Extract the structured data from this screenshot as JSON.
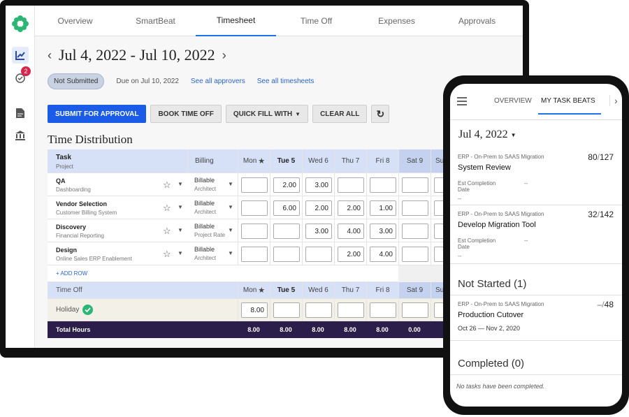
{
  "app": {
    "tabs": [
      "Overview",
      "SmartBeat",
      "Timesheet",
      "Time Off",
      "Expenses",
      "Approvals"
    ],
    "active_tab": "Timesheet",
    "notification_count": "2"
  },
  "timesheet": {
    "date_range": "Jul 4, 2022 - Jul 10, 2022",
    "status": "Not Submitted",
    "due": "Due on Jul 10, 2022",
    "see_approvers": "See all approvers",
    "see_timesheets": "See all timesheets",
    "buttons": {
      "submit": "SUBMIT FOR APPROVAL",
      "book": "BOOK TIME OFF",
      "quick_fill": "QUICK FILL WITH",
      "clear": "CLEAR ALL"
    },
    "section_title": "Time Distribution",
    "header": {
      "task": "Task",
      "project": "Project",
      "billing": "Billing",
      "days": [
        "Mon",
        "Tue 5",
        "Wed 6",
        "Thu 7",
        "Fri 8",
        "Sat 9",
        "Su"
      ]
    },
    "rows": [
      {
        "task": "QA",
        "project": "Dashboarding",
        "billing": "Billable",
        "role": "Architect",
        "hours": [
          "",
          "2.00",
          "3.00",
          "",
          "",
          "",
          ""
        ]
      },
      {
        "task": "Vendor Selection",
        "project": "Customer Billing System",
        "billing": "Billable",
        "role": "Architect",
        "hours": [
          "",
          "6.00",
          "2.00",
          "2.00",
          "1.00",
          "",
          ""
        ]
      },
      {
        "task": "Discovery",
        "project": "Financial Reporting",
        "billing": "Billable",
        "role": "Project Rate",
        "hours": [
          "",
          "",
          "3.00",
          "4.00",
          "3.00",
          "",
          ""
        ]
      },
      {
        "task": "Design",
        "project": "Online Sales ERP Enablement",
        "billing": "Billable",
        "role": "Architect",
        "hours": [
          "",
          "",
          "",
          "2.00",
          "4.00",
          "",
          ""
        ]
      }
    ],
    "add_row": "+ ADD ROW",
    "time_off_header": "Time Off",
    "holiday": {
      "label": "Holiday",
      "hours": [
        "8.00",
        "",
        "",
        "",
        "",
        "",
        ""
      ]
    },
    "total_label": "Total Hours",
    "totals": [
      "8.00",
      "8.00",
      "8.00",
      "8.00",
      "8.00",
      "0.00",
      ""
    ]
  },
  "mobile": {
    "tabs": [
      "OVERVIEW",
      "MY TASK BEATS"
    ],
    "active_tab": "MY TASK BEATS",
    "date": "Jul 4, 2022",
    "tasks": [
      {
        "project": "ERP - On-Prem to SAAS Migration",
        "title": "System Review",
        "done": "80",
        "total": "127",
        "est_label": "Est Completion Date",
        "est_value": "--",
        "est_value2": "--"
      },
      {
        "project": "ERP - On-Prem to SAAS Migration",
        "title": "Develop Migration Tool",
        "done": "32",
        "total": "142",
        "est_label": "Est Completion Date",
        "est_value": "--",
        "est_value2": "--"
      }
    ],
    "not_started_label": "Not Started (1)",
    "not_started": {
      "project": "ERP - On-Prem to SAAS Migration",
      "title": "Production Cutover",
      "dates": "Oct 26 — Nov 2, 2020",
      "done": "–",
      "total": "48"
    },
    "completed_label": "Completed (0)",
    "empty_message": "No tasks have been completed."
  },
  "colors": {
    "primary": "#1a5ce8",
    "header": "#d6e0f7",
    "total_bar": "#2c1e4a",
    "badge": "#d9254c",
    "logo": "#2bb673",
    "check": "#2bb673"
  }
}
